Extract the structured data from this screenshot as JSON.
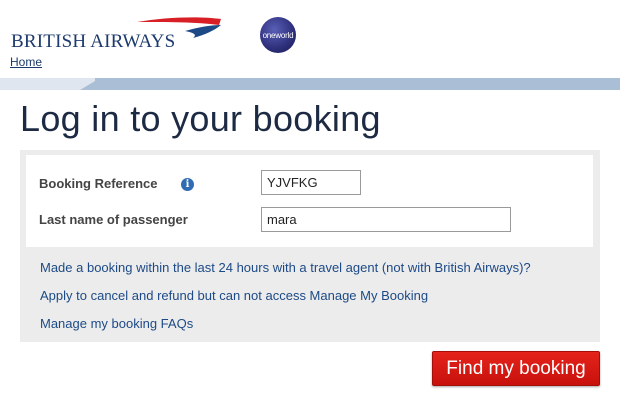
{
  "header": {
    "brand_name": "BRITISH AIRWAYS",
    "alliance_badge": "oneworld",
    "home_link": "Home",
    "brand_red": "#d81f26",
    "brand_blue": "#1d3a6e"
  },
  "page": {
    "title": "Log in to your booking"
  },
  "form": {
    "booking_reference_label": "Booking Reference",
    "booking_reference_value": "YJVFKG",
    "last_name_label": "Last name of passenger",
    "last_name_value": "mara"
  },
  "links": [
    "Made a booking within the last 24 hours with a travel agent (not with British Airways)?",
    "Apply to cancel and refund but can not access Manage My Booking",
    "Manage my booking FAQs"
  ],
  "actions": {
    "find_button": "Find my booking"
  },
  "icons": {
    "info": "info-icon",
    "logo": "speedmarque-logo-icon"
  }
}
